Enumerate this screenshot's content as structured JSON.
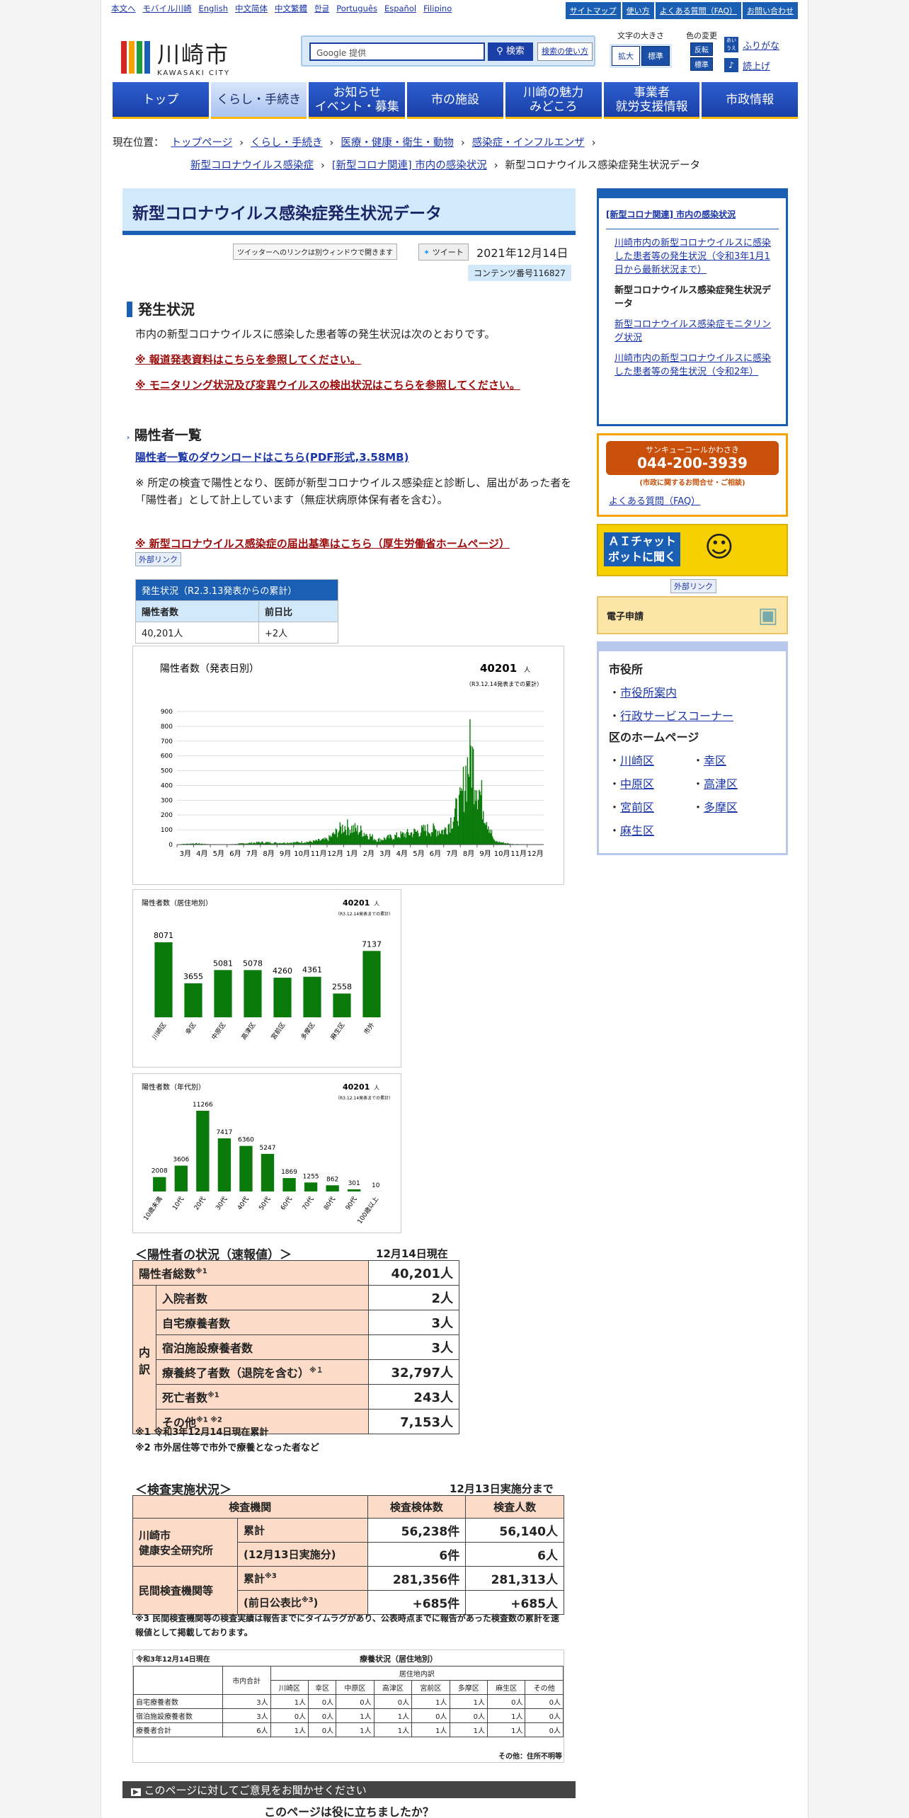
{
  "header": {
    "toplinks": [
      "本文へ",
      "モバイル川崎",
      "English",
      "中文简体",
      "中文繁體",
      "한글",
      "Português",
      "Español",
      "Filipino"
    ],
    "util": [
      "サイトマップ",
      "使い方",
      "よくある質問（FAQ）",
      "お問い合わせ"
    ],
    "logo_jp": "川崎市",
    "logo_en": "KAWASAKI CITY",
    "search_placeholder": "Google 提供",
    "search_btn": "検索",
    "search_how": "検索の使い方",
    "fontsize_label": "文字の大きさ",
    "fontsize_big": "拡大",
    "fontsize_std": "標準",
    "color_label": "色の変更",
    "color_inv": "反転",
    "color_std": "標準",
    "furigana": "ふりがな",
    "yomiage": "読上げ",
    "fontsize_icon": "あいうえ"
  },
  "nav": [
    "トップ",
    "くらし・手続き",
    "お知らせ\nイベント・募集",
    "市の施設",
    "川崎の魅力\nみどころ",
    "事業者\n就労支援情報",
    "市政情報"
  ],
  "breadcrumb": {
    "label": "現在位置：",
    "items": [
      "トップページ",
      "くらし・手続き",
      "医療・健康・衛生・動物",
      "感染症・インフルエンザ",
      "新型コロナウイルス感染症",
      "[新型コロナ関連] 市内の感染状況"
    ],
    "current": "新型コロナウイルス感染症発生状況データ"
  },
  "main": {
    "title": "新型コロナウイルス感染症発生状況データ",
    "tweet_note": "ツイッターへのリンクは別ウィンドウで開きます",
    "tweet_btn": "ツイート",
    "date": "2021年12月14日",
    "content_no": "コンテンツ番号116827",
    "h_status": "発生状況",
    "intro": "市内の新型コロナウイルスに感染した患者等の発生状況は次のとおりです。",
    "red1": "※ 報道発表資料はこちらを参照してください。",
    "red2": "※ モニタリング状況及び変異ウイルスの検出状況はこちらを参照してください。",
    "h_list": "陽性者一覧",
    "pdf_link": "陽性者一覧のダウンロードはこちら(PDF形式,3.58MB)",
    "desc": "※ 所定の検査で陽性となり、医師が新型コロナウイルス感染症と診断し、届出があった者を「陽性者」として計上しています（無症状病原体保有者を含む）。",
    "red3": "※ 新型コロナウイルス感染症の届出基準はこちら（厚生労働省ホームページ）",
    "ext": "外部リンク",
    "small_table": {
      "caption": "発生状況（R2.3.13発表からの累計）",
      "h1": "陽性者数",
      "h2": "前日比",
      "v1": "40,201人",
      "v2": "+2人"
    }
  },
  "chart_data": [
    {
      "type": "bar",
      "title": "陽性者数（発表日別）",
      "total": "40201",
      "unit": "人",
      "note": "（R3.12.14発表までの累計）",
      "yticks": [
        0,
        100,
        200,
        300,
        400,
        500,
        600,
        700,
        800,
        900
      ],
      "ylim": [
        0,
        900
      ],
      "xticks": [
        "3月",
        "4月",
        "5月",
        "6月",
        "7月",
        "8月",
        "9月",
        "10月",
        "11月",
        "12月",
        "1月",
        "2月",
        "3月",
        "4月",
        "5月",
        "6月",
        "7月",
        "8月",
        "9月",
        "10月",
        "11月",
        "12月"
      ],
      "series_approx": [
        {
          "x": [
            0,
            1,
            2,
            3,
            4,
            5,
            6,
            7,
            8,
            9,
            10,
            11,
            12,
            13,
            14,
            15,
            16,
            17,
            17.3,
            17.6,
            17.9,
            18.2,
            18.5,
            18.8,
            19,
            20,
            21
          ],
          "y": [
            2,
            10,
            3,
            1,
            10,
            20,
            15,
            18,
            25,
            45,
            160,
            120,
            40,
            70,
            100,
            130,
            120,
            350,
            620,
            790,
            600,
            420,
            260,
            120,
            30,
            5,
            2
          ]
        }
      ]
    },
    {
      "type": "bar",
      "title": "陽性者数（居住地別）",
      "total": "40201",
      "unit": "人",
      "note": "（R3.12.14発表までの累計）",
      "categories": [
        "川崎区",
        "幸区",
        "中原区",
        "高津区",
        "宮前区",
        "多摩区",
        "麻生区",
        "市外"
      ],
      "values": [
        8071,
        3655,
        5081,
        5078,
        4260,
        4361,
        2558,
        7137
      ]
    },
    {
      "type": "bar",
      "title": "陽性者数（年代別）",
      "total": "40201",
      "unit": "人",
      "note": "（R3.12.14発表までの累計）",
      "categories": [
        "10歳未満",
        "10代",
        "20代",
        "30代",
        "40代",
        "50代",
        "60代",
        "70代",
        "80代",
        "90代",
        "100歳以上"
      ],
      "values": [
        2008,
        3606,
        11266,
        7417,
        6360,
        5247,
        1869,
        1255,
        862,
        301,
        10
      ]
    }
  ],
  "status": {
    "title": "＜陽性者の状況（速報値）＞",
    "asof": "12月14日現在",
    "total_label": "陽性者総数",
    "total_mark": "※1",
    "total": "40,201人",
    "uchi": "内訳",
    "rows": [
      [
        "入院者数",
        "",
        "2人"
      ],
      [
        "自宅療養者数",
        "",
        "3人"
      ],
      [
        "宿泊施設療養者数",
        "",
        "3人"
      ],
      [
        "療養終了者数（退院を含む）",
        "※１",
        "32,797人"
      ],
      [
        "死亡者数",
        "※1",
        "243人"
      ],
      [
        "その他",
        "※1 ※2",
        "7,153人"
      ]
    ],
    "note1": "※1 令和3年12月14日現在累計",
    "note2": "※2 市外居住等で市外で療養となった者など"
  },
  "exam": {
    "title": "＜検査実施状況＞",
    "asof": "12月13日実施分まで",
    "h": [
      "検査機関",
      "検査検体数",
      "検査人数"
    ],
    "org1": "川崎市\n健康安全研究所",
    "org2": "民間検査機関等",
    "r1": [
      "累計",
      "56,238件",
      "56,140人"
    ],
    "r2": [
      "(12月13日実施分)",
      "6件",
      "6人"
    ],
    "r3": [
      "累計",
      "281,356件",
      "281,313人"
    ],
    "r3mark": "※3",
    "r4": [
      "(前日公表比",
      "+685件",
      "+685人"
    ],
    "r4mark": "※3",
    "note": "※3 民間検査機関等の検査実績は報告までにタイムラグがあり、公表時点までに報告があった検査数の累計を速報値として掲載しております。"
  },
  "ryoyo": {
    "asof": "令和3年12月14日現在",
    "title": "療養状況（居住地別）",
    "total": "市内合計",
    "sub": "居住地内訳",
    "cols": [
      "川崎区",
      "幸区",
      "中原区",
      "高津区",
      "宮前区",
      "多摩区",
      "麻生区",
      "その他"
    ],
    "rows": [
      {
        "label": "自宅療養者数",
        "total": "3人",
        "vals": [
          "1人",
          "0人",
          "0人",
          "0人",
          "1人",
          "1人",
          "0人",
          "0人"
        ]
      },
      {
        "label": "宿泊施設療養者数",
        "total": "3人",
        "vals": [
          "0人",
          "0人",
          "1人",
          "1人",
          "0人",
          "0人",
          "1人",
          "0人"
        ]
      },
      {
        "label": "療養者合計",
        "total": "6人",
        "vals": [
          "1人",
          "0人",
          "1人",
          "1人",
          "1人",
          "1人",
          "1人",
          "0人"
        ]
      }
    ],
    "foot": "その他：住所不明等"
  },
  "feedback": {
    "bar": "このページに対してご意見をお聞かせください",
    "q": "このページは役に立ちましたか？"
  },
  "sidebar": {
    "head": "[新型コロナ関連] 市内の感染状況",
    "items": [
      "川崎市内の新型コロナウイルスに感染した患者等の発生状況（令和3年1月1日から最新状況まで）",
      "新型コロナウイルス感染症発生状況データ",
      "新型コロナウイルス感染症モニタリング状況",
      "川崎市内の新型コロナウイルスに感染した患者等の発生状況（令和2年）"
    ],
    "call_name": "サンキューコールかわさき",
    "call_tel": "044-200-3939",
    "call_sub": "(市政に関するお問合せ・ご相談)",
    "faq": "よくある質問（FAQ）",
    "chat": "ＡＩチャット\nボットに聞く",
    "chat_ext": "外部リンク",
    "denshi": "電子申請",
    "city_h": "市役所",
    "city": [
      "市役所案内",
      "行政サービスコーナー"
    ],
    "ward_h": "区のホームページ",
    "wards": [
      "川崎区",
      "幸区",
      "中原区",
      "高津区",
      "宮前区",
      "多摩区",
      "麻生区"
    ]
  },
  "colors": {
    "accent": "#1a5fb4",
    "bar": "#0a7a0a",
    "peach": "#fcdcc8",
    "red": "#9b0b0b"
  }
}
